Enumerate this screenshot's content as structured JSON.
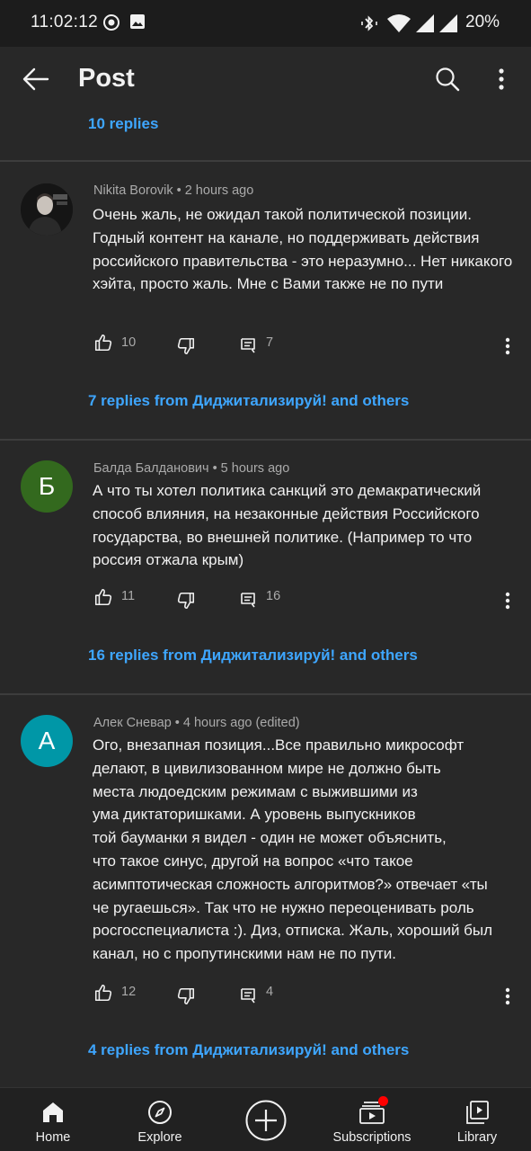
{
  "status_bar": {
    "time": "11:02:12",
    "battery": "20%"
  },
  "app_bar": {
    "title": "Post",
    "icons": [
      "back-arrow-icon",
      "search-icon",
      "more-vert-icon"
    ]
  },
  "top_replies_link": "10 replies",
  "comments": [
    {
      "author": "Nikita Borovik",
      "time": "2 hours ago",
      "avatar_letter": "",
      "avatar_color": "#1a1a1a",
      "text": "Очень жаль, не ожидал такой политической позиции. Годный контент на канале, но поддерживать действия российского правительства - это неразумно... Нет никакого хэйта, просто жаль. Мне с Вами также не по пути",
      "likes": "10",
      "replies": "7",
      "replies_link": "7 replies from Диджитализируй! and others"
    },
    {
      "author": "Балда Балданович",
      "time": "5 hours ago",
      "avatar_letter": "Б",
      "avatar_color": "#33691e",
      "text": "А что ты хотел политика санкций это демакратический способ влияния, на незаконные действия Российского государства, во внешней политике. (Например то что россия отжала крым)",
      "likes": "11",
      "replies": "16",
      "replies_link": "16 replies from Диджитализируй! and others"
    },
    {
      "author": "Алек Сневар",
      "time": "4 hours ago (edited)",
      "avatar_letter": "А",
      "avatar_color": "#0097a7",
      "text_lines": [
        "Ого, внезапная позиция...Все правильно микрософт",
        "делают, в цивилизованном мире не должно быть",
        "места людоедским режимам с выжившими из",
        "ума диктаторишками. А уровень выпускников",
        "той бауманки я видел - один не может объяснить,",
        "что такое синус, другой на вопрос «что такое",
        "асимптотическая сложность алгоритмов?» отвечает «ты",
        "че ругаешься». Так что не нужно переоценивать роль",
        "росгосспециалиста :). Диз, отписка. Жаль, хороший был",
        "канал, но с пропутинскими нам не по пути."
      ],
      "likes": "12",
      "replies": "4",
      "replies_link": "4 replies from Диджитализируй! and others"
    }
  ],
  "bottom_nav": {
    "items": [
      {
        "label": "Home",
        "icon": "home-icon"
      },
      {
        "label": "Explore",
        "icon": "compass-icon"
      },
      {
        "label": "",
        "icon": "create-plus-icon"
      },
      {
        "label": "Subscriptions",
        "icon": "subscriptions-icon"
      },
      {
        "label": "Library",
        "icon": "library-icon"
      }
    ],
    "notification_dot_color": "#ff0000"
  },
  "colors": {
    "background": "#282828",
    "link": "#3ea6ff",
    "meta_text": "#aaaaaa"
  }
}
